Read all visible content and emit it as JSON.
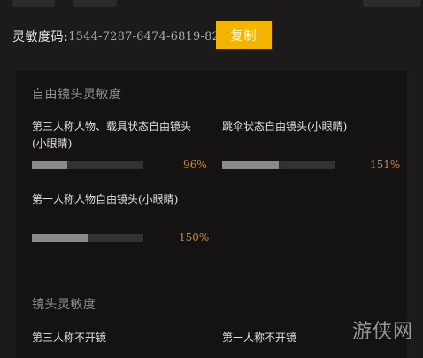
{
  "header": {
    "code_label": "灵敏度码:",
    "code_value": "1544-7287-6474-6819-82",
    "copy_button": "复制"
  },
  "free_camera": {
    "title": "自由镜头灵敏度",
    "settings": [
      {
        "label_line1": "第三人称人物、载具状态自由镜头",
        "label_line2": "(小眼睛)",
        "value": "96%",
        "fill": 0.32
      },
      {
        "label_line1": "跳伞状态自由镜头(小眼睛)",
        "label_line2": "",
        "value": "151%",
        "fill": 0.5
      },
      {
        "label_line1": "第一人称人物自由镜头(小眼睛)",
        "label_line2": "",
        "value": "150%",
        "fill": 0.5
      }
    ]
  },
  "camera": {
    "title": "镜头灵敏度",
    "settings": [
      {
        "label": "第三人称不开镜"
      },
      {
        "label": "第一人称不开镜"
      }
    ]
  },
  "watermark": "游侠网"
}
